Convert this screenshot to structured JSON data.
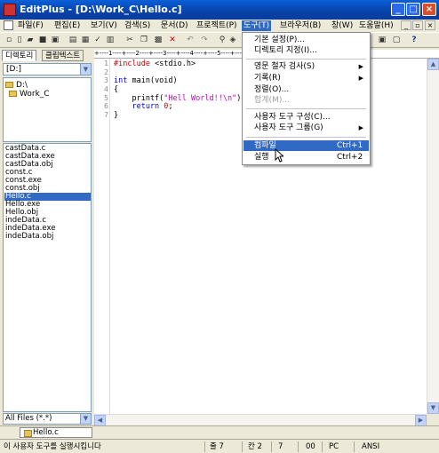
{
  "window": {
    "title": "EditPlus - [D:\\Work_C\\Hello.c]"
  },
  "menubar": {
    "items": [
      "파일(F)",
      "편집(E)",
      "보기(V)",
      "검색(S)",
      "문서(D)",
      "프로젝트(P)",
      "도구(T)",
      "브라우저(B)",
      "창(W)",
      "도움말(H)"
    ],
    "active": "도구(T)"
  },
  "sidebar": {
    "tabs": [
      "디렉토리",
      "클립텍스트"
    ],
    "drive": "[D:]",
    "folders": [
      "D:\\",
      "Work_C"
    ],
    "files": [
      "castData.c",
      "castData.exe",
      "castData.obj",
      "const.c",
      "const.exe",
      "const.obj",
      "Hello.c",
      "Hello.exe",
      "Hello.obj",
      "indeData.c",
      "indeData.exe",
      "indeData.obj"
    ],
    "selected_file": "Hello.c",
    "filter": "All Files (*.*)"
  },
  "editor": {
    "ruler": "+----1----+----2----+----3----+----4----+----5----+----6----+----7----+----8----+",
    "line_numbers": [
      "1",
      "2",
      "3",
      "4",
      "5",
      "6",
      "7"
    ],
    "code": {
      "l1_dir": "#include",
      "l1_rest": " <stdio.h>",
      "l3_kw": "int",
      "l3_rest": " main(void)",
      "l4": "{",
      "l5_pre": "    printf(",
      "l5_str": "\"Hell World!!\\n\"",
      "l5_post": ");",
      "l6_kw": "    return",
      "l6_num": " 0",
      "l6_post": ";",
      "l7": "}"
    }
  },
  "doc_tabs": {
    "active": "Hello.c"
  },
  "statusbar": {
    "message": "이 사용자 도구를 실행시킵니다",
    "line": "줄 7",
    "col": "칸 2",
    "lines": "7",
    "code": "00",
    "mode": "PC",
    "encoding": "ANSI"
  },
  "tools_menu": {
    "items": [
      {
        "label": "기본 설정(P)...",
        "shortcut": "",
        "submenu": false,
        "disabled": false
      },
      {
        "label": "디렉토리 지정(I)...",
        "shortcut": "",
        "submenu": false,
        "disabled": false
      },
      {
        "label": "영문 철자 검사(S)",
        "shortcut": "",
        "submenu": true,
        "disabled": false
      },
      {
        "label": "기록(R)",
        "shortcut": "",
        "submenu": true,
        "disabled": false
      },
      {
        "label": "정렬(O)...",
        "shortcut": "",
        "submenu": false,
        "disabled": false
      },
      {
        "label": "합계(M)...",
        "shortcut": "",
        "submenu": false,
        "disabled": true
      },
      {
        "label": "사용자 도구 구성(C)...",
        "shortcut": "",
        "submenu": false,
        "disabled": false
      },
      {
        "label": "사용자 도구 그룹(G)",
        "shortcut": "",
        "submenu": true,
        "disabled": false
      },
      {
        "label": "컴파일",
        "shortcut": "Ctrl+1",
        "submenu": false,
        "disabled": false
      },
      {
        "label": "실행",
        "shortcut": "Ctrl+2",
        "submenu": false,
        "disabled": false
      }
    ],
    "highlighted": "컴파일"
  }
}
